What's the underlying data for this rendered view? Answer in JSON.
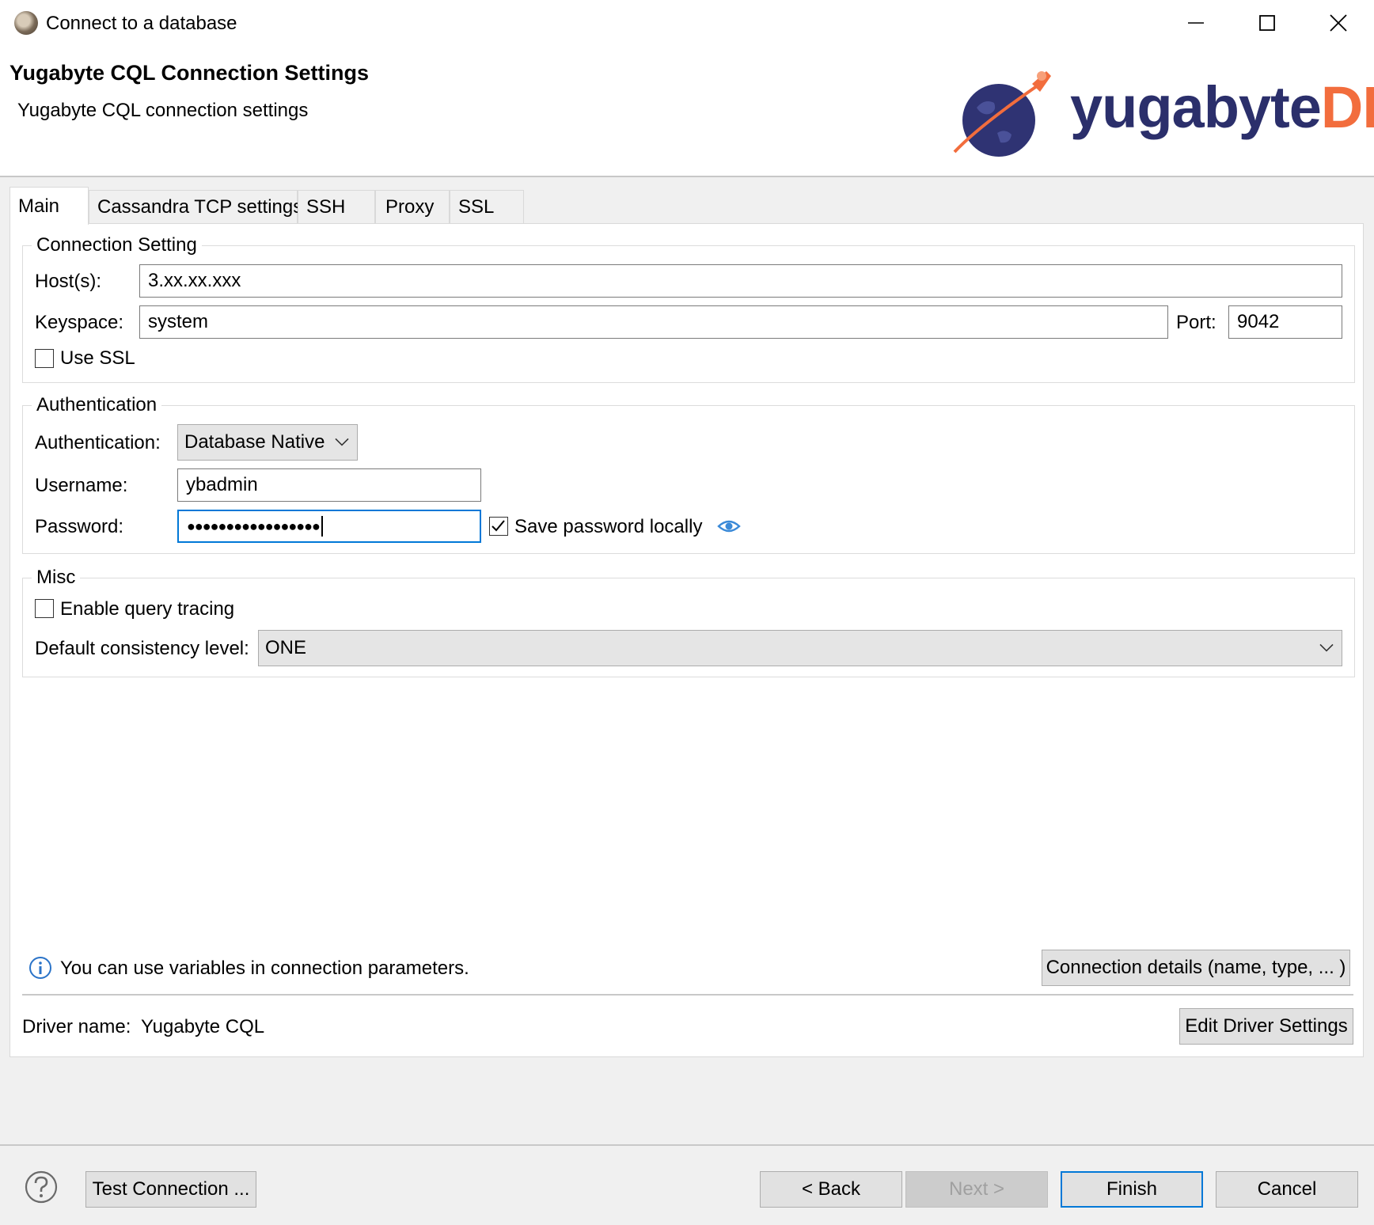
{
  "window": {
    "title": "Connect to a database",
    "app_icon": "dbeaver-icon"
  },
  "header": {
    "title": "Yugabyte CQL Connection Settings",
    "subtitle": "Yugabyte CQL connection settings",
    "logo": {
      "text_main": "yugabyte",
      "text_accent": "DB",
      "color_main": "#2b2f6b",
      "color_accent": "#f26d3d"
    }
  },
  "tabs": [
    {
      "label": "Main",
      "active": true
    },
    {
      "label": "Cassandra TCP settings",
      "active": false
    },
    {
      "label": "SSH",
      "active": false
    },
    {
      "label": "Proxy",
      "active": false
    },
    {
      "label": "SSL",
      "active": false
    }
  ],
  "connection": {
    "legend": "Connection Setting",
    "hosts_label": "Host(s):",
    "hosts_value": "3.xx.xx.xxx",
    "keyspace_label": "Keyspace:",
    "keyspace_value": "system",
    "port_label": "Port:",
    "port_value": "9042",
    "use_ssl_label": "Use SSL",
    "use_ssl_checked": false
  },
  "authentication": {
    "legend": "Authentication",
    "auth_label": "Authentication:",
    "auth_value": "Database Native",
    "username_label": "Username:",
    "username_value": "ybadmin",
    "password_label": "Password:",
    "password_value": "●●●●●●●●●●●●●●●●●",
    "save_password_label": "Save password locally",
    "save_password_checked": true
  },
  "misc": {
    "legend": "Misc",
    "query_tracing_label": "Enable query tracing",
    "query_tracing_checked": false,
    "consistency_label": "Default consistency level:",
    "consistency_value": "ONE"
  },
  "footer": {
    "info_text": "You can use variables in connection parameters.",
    "details_button": "Connection details (name, type, ... )",
    "driver_label": "Driver name:",
    "driver_value": "Yugabyte CQL",
    "edit_driver_button": "Edit Driver Settings"
  },
  "actions": {
    "test_connection": "Test Connection ...",
    "back": "< Back",
    "next": "Next >",
    "finish": "Finish",
    "cancel": "Cancel"
  },
  "colors": {
    "accent": "#0078d7",
    "eye_icon": "#3b8ad8"
  }
}
